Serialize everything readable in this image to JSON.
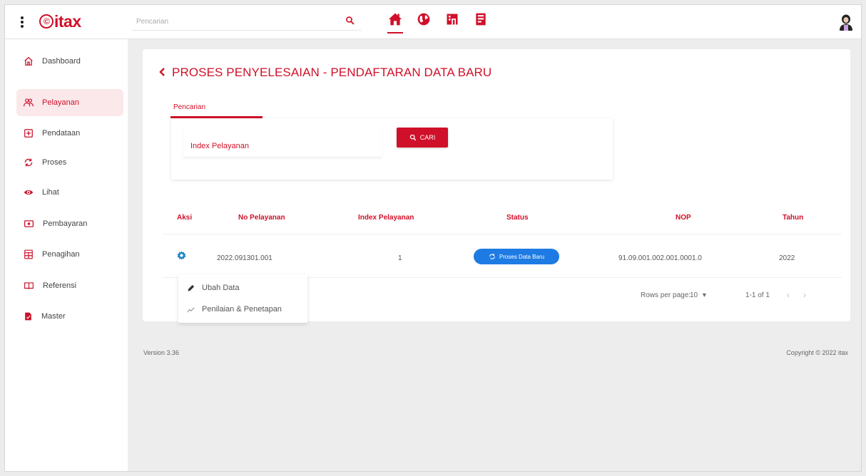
{
  "app": {
    "logo_text": "itax",
    "logo_symbol": "©"
  },
  "header": {
    "search_placeholder": "Pencarian",
    "icons": [
      "home-icon",
      "globe-icon",
      "building-icon",
      "document-icon"
    ],
    "active_icon": "home-icon",
    "accent_color": "#d0102a"
  },
  "sidebar": {
    "items": [
      {
        "label": "Dashboard",
        "icon": "home-outline-icon",
        "active": false
      },
      {
        "label": "Pelayanan",
        "icon": "users-icon",
        "active": true
      },
      {
        "label": "Pendataan",
        "icon": "plus-box-icon",
        "active": false
      },
      {
        "label": "Proses",
        "icon": "sync-icon",
        "active": false
      },
      {
        "label": "Lihat",
        "icon": "eye-icon",
        "active": false
      },
      {
        "label": "Pembayaran",
        "icon": "cash-icon",
        "active": false
      },
      {
        "label": "Penagihan",
        "icon": "calculator-icon",
        "active": false
      },
      {
        "label": "Referensi",
        "icon": "book-open-icon",
        "active": false
      },
      {
        "label": "Master",
        "icon": "file-icon",
        "active": false
      }
    ]
  },
  "main": {
    "title": "PROSES PENYELESAIAN - PENDAFTARAN DATA BARU",
    "tab_label": "Pencarian",
    "search": {
      "placeholder": "Index Pelayanan",
      "button_label": "CARI"
    },
    "table": {
      "headers": [
        "Aksi",
        "No Pelayanan",
        "Index Pelayanan",
        "Status",
        "NOP",
        "Tahun"
      ],
      "rows": [
        {
          "no_pelayanan": "2022.091301.001",
          "index_pelayanan": "1",
          "status": "Proses Data Baru",
          "nop": "91.09.001.002.001.0001.0",
          "tahun": "2022"
        }
      ],
      "rows_per_page_label": "Rows per page:",
      "rows_per_page_value": "10",
      "range": "1-1 of 1"
    },
    "action_menu": [
      {
        "label": "Ubah Data",
        "icon": "pencil-icon"
      },
      {
        "label": "Penilaian & Penetapan",
        "icon": "chart-line-icon"
      }
    ]
  },
  "footer": {
    "version": "Version 3.36",
    "copyright": "Copyright © 2022 itax"
  },
  "colors": {
    "accent": "#d0102a",
    "status_chip": "#1e7be4",
    "active_nav_bg": "#fbe8ea"
  }
}
